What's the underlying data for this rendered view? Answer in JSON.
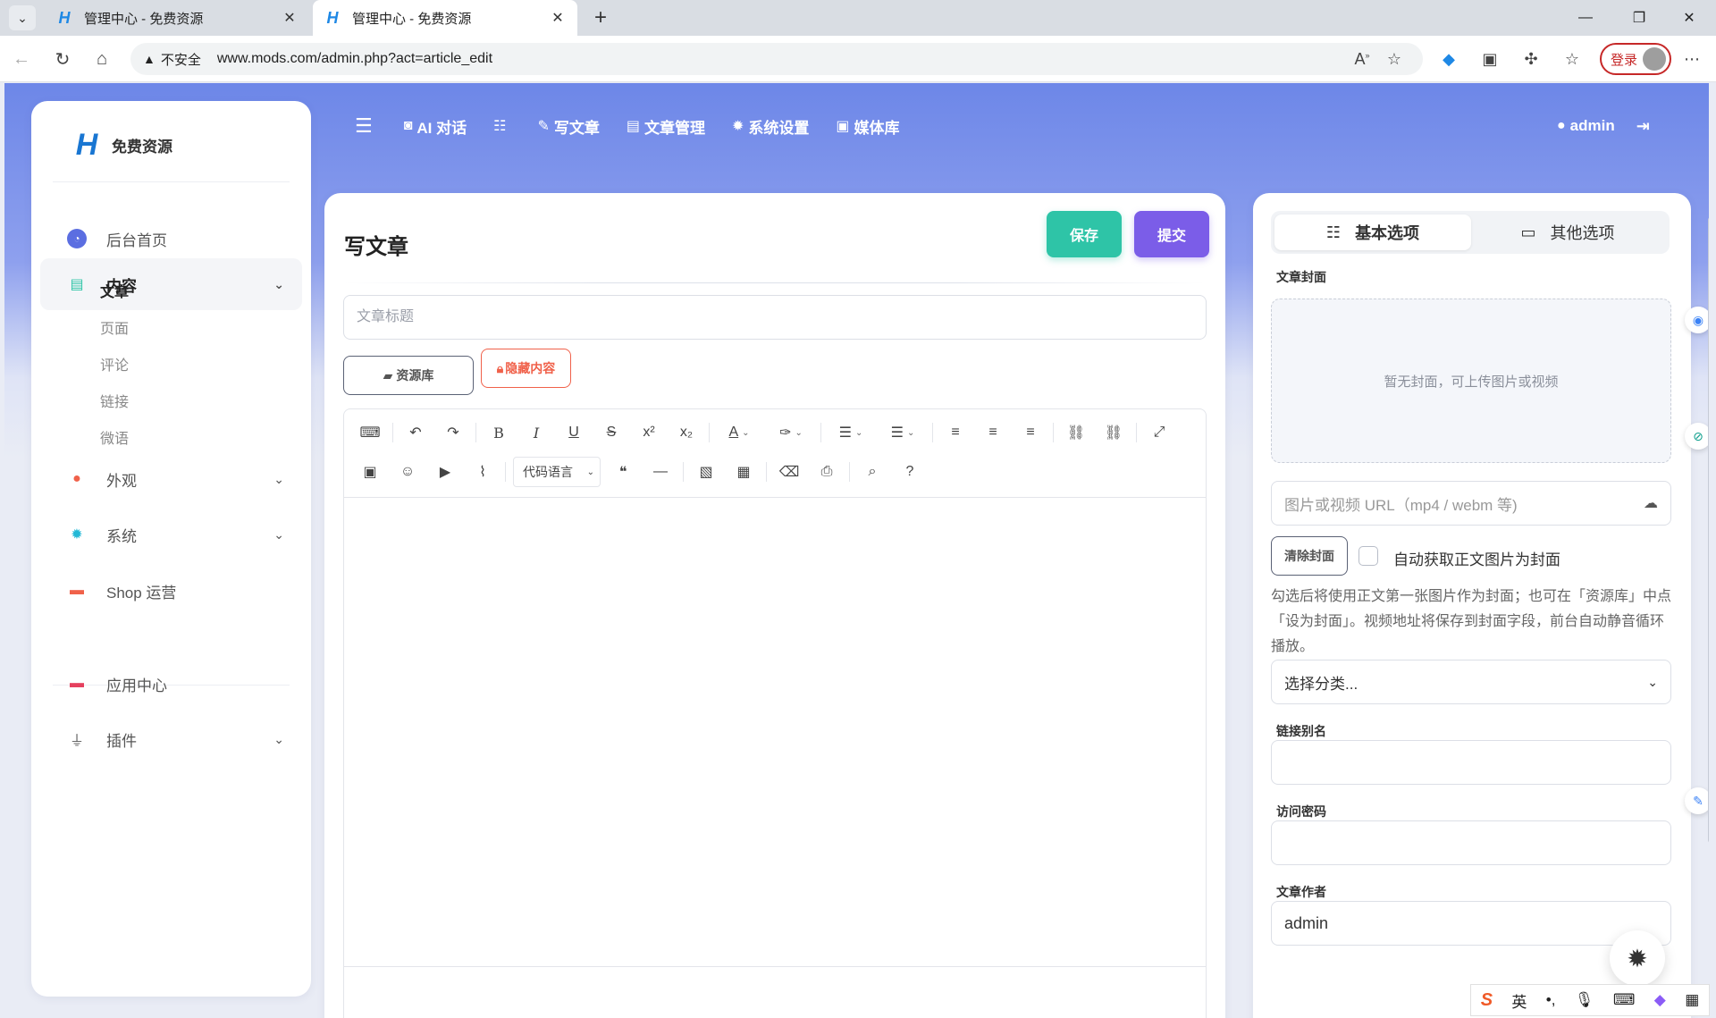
{
  "browser": {
    "tabs": [
      {
        "title": "管理中心 - 免费资源",
        "favicon": "H"
      },
      {
        "title": "管理中心 - 免费资源",
        "favicon": "H"
      }
    ],
    "insecure_label": "不安全",
    "url": "www.mods.com/admin.php?act=article_edit",
    "login_label": "登录"
  },
  "brand": {
    "name": "免费资源",
    "logo": "H"
  },
  "sidebar": {
    "home": "后台首页",
    "content": "内容",
    "content_sub": [
      "文章",
      "页面",
      "评论",
      "链接",
      "微语"
    ],
    "appearance": "外观",
    "system": "系统",
    "shop": "Shop 运营",
    "app_center": "应用中心",
    "plugins": "插件"
  },
  "topnav": {
    "ai": "AI 对话",
    "write": "写文章",
    "manage": "文章管理",
    "settings": "系统设置",
    "media": "媒体库",
    "user": "admin"
  },
  "editor": {
    "heading": "写文章",
    "save": "保存",
    "submit": "提交",
    "title_placeholder": "文章标题",
    "resource_lib": "资源库",
    "hidden_content": "隐藏内容",
    "code_language": "代码语言"
  },
  "panel": {
    "tab_basic": "基本选项",
    "tab_other": "其他选项",
    "cover_label": "文章封面",
    "cover_empty": "暂无封面，可上传图片或视频",
    "cover_url_placeholder": "图片或视频 URL（mp4 / webm 等)",
    "clear_cover": "清除封面",
    "auto_cover": "自动获取正文图片为封面",
    "help_text": "勾选后将使用正文第一张图片作为封面；也可在「资源库」中点「设为封面」。视频地址将保存到封面字段，前台自动静音循环播放。",
    "category_placeholder": "选择分类...",
    "slug_label": "链接别名",
    "password_label": "访问密码",
    "author_label": "文章作者",
    "author_value": "admin"
  },
  "ime": {
    "lang": "英"
  },
  "colors": {
    "header_gradient": "#6d87e8",
    "save": "#2ec4a7",
    "submit": "#7b5de8",
    "hidden": "#f0614a"
  }
}
